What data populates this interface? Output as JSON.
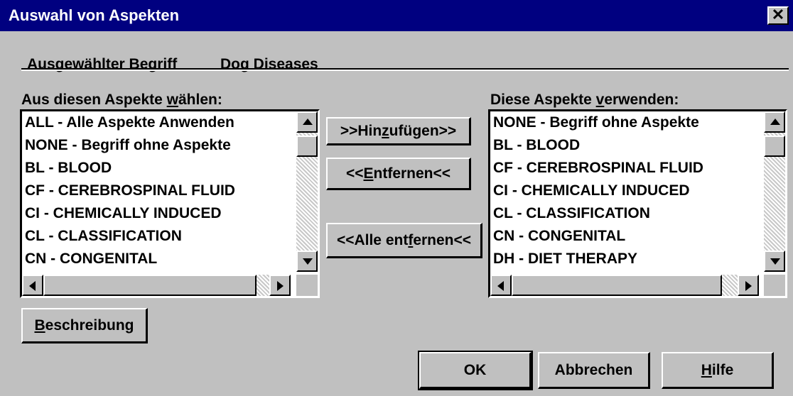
{
  "window": {
    "title": "Auswahl von Aspekten",
    "close_glyph": "✕"
  },
  "term": {
    "label": "Ausgewählter Begriff",
    "value": "Dog Diseases"
  },
  "left_list": {
    "header_pre": "Aus diesen Aspekte ",
    "header_hot": "w",
    "header_post": "ählen:",
    "items": [
      "ALL - Alle Aspekte Anwenden",
      "NONE - Begriff ohne Aspekte",
      "BL - BLOOD",
      "CF - CEREBROSPINAL FLUID",
      "CI - CHEMICALLY INDUCED",
      "CL - CLASSIFICATION",
      "CN - CONGENITAL"
    ]
  },
  "right_list": {
    "header_pre": "Diese Aspekte ",
    "header_hot": "v",
    "header_post": "erwenden:",
    "items": [
      "NONE - Begriff ohne Aspekte",
      "BL - BLOOD",
      "CF - CEREBROSPINAL FLUID",
      "CI - CHEMICALLY INDUCED",
      "CL - CLASSIFICATION",
      "CN - CONGENITAL",
      "DH - DIET THERAPY"
    ]
  },
  "buttons": {
    "add": {
      "pre": ">>Hin",
      "hot": "z",
      "post": "ufügen>>"
    },
    "remove": {
      "pre": "<<",
      "hot": "E",
      "post": "ntfernen<<"
    },
    "remove_all": {
      "pre": "<<Alle ent",
      "hot": "f",
      "post": "ernen<<"
    },
    "describe": {
      "pre": "",
      "hot": "B",
      "post": "eschreibung"
    },
    "ok": "OK",
    "cancel": "Abbrechen",
    "help": {
      "pre": "",
      "hot": "H",
      "post": "ilfe"
    }
  },
  "icons": {
    "scroll_up": "triangle-up-icon",
    "scroll_down": "triangle-down-icon",
    "scroll_left": "triangle-left-icon",
    "scroll_right": "triangle-right-icon"
  }
}
